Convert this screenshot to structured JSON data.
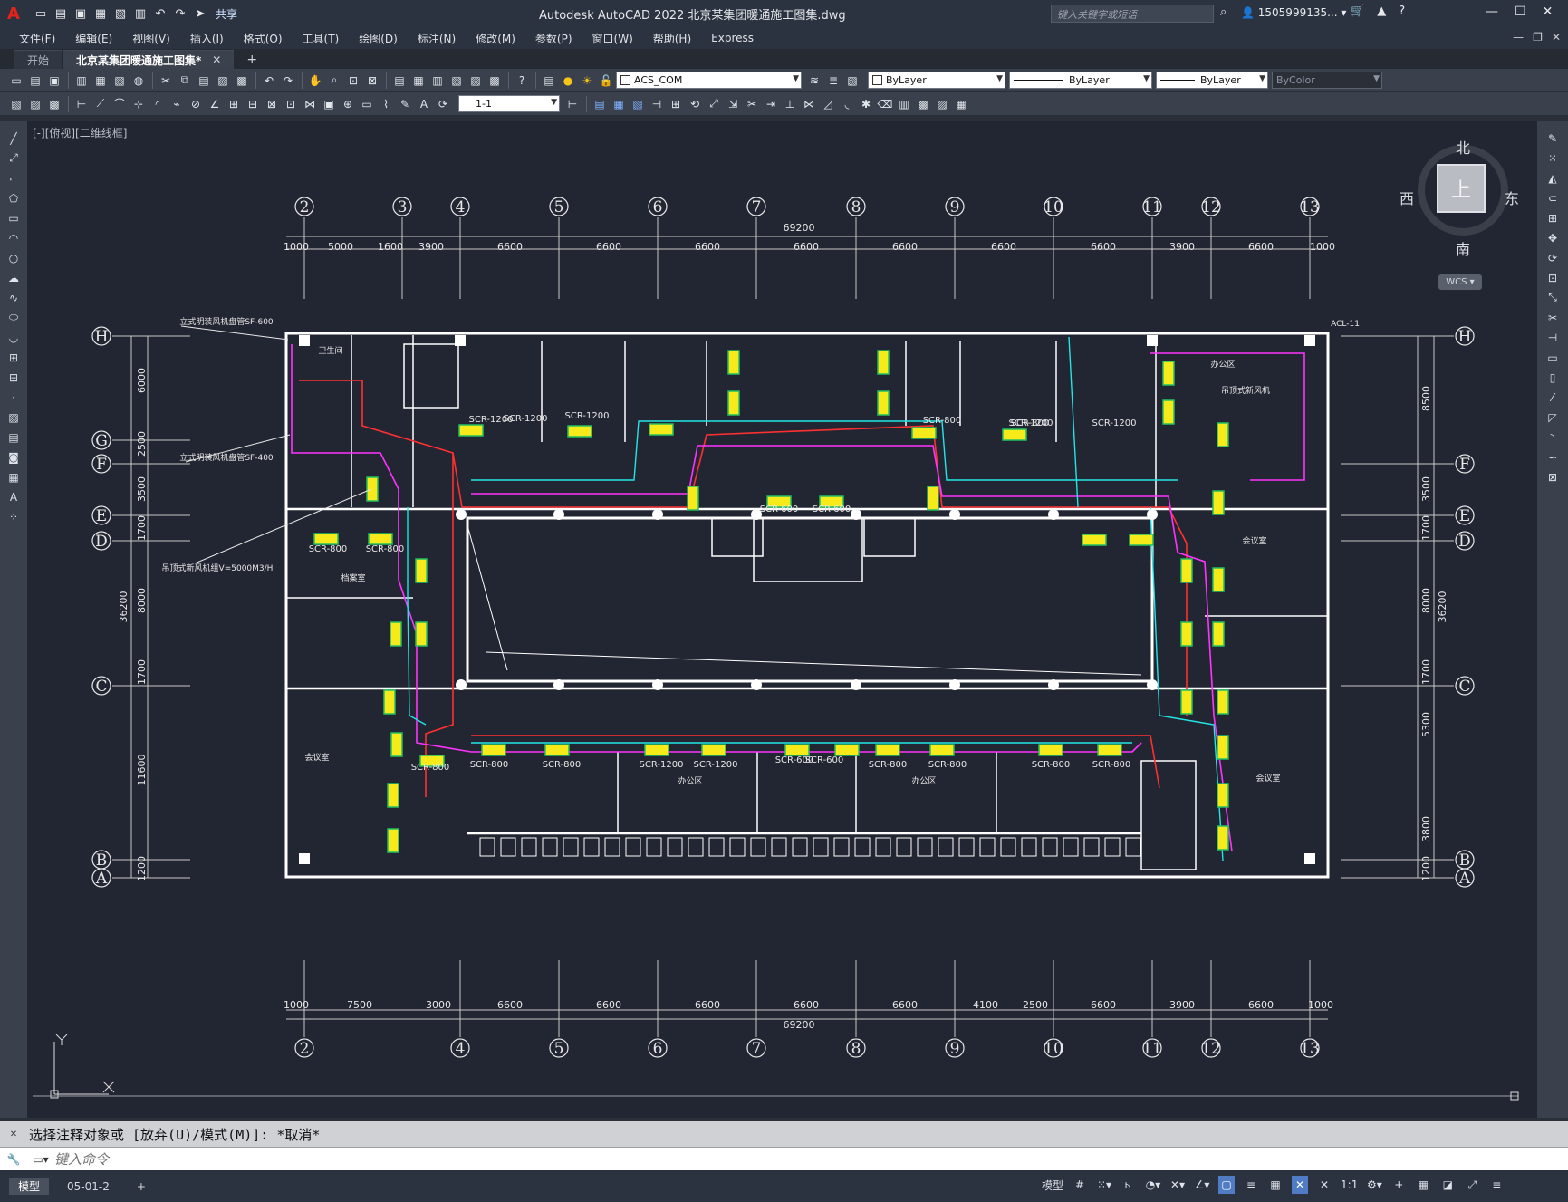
{
  "app": {
    "title": "Autodesk AutoCAD 2022    北京某集团暖通施工图集.dwg",
    "share_label": "共享",
    "search_placeholder": "键入关键字或短语",
    "user": "1505999135...",
    "accent": "#e2231a"
  },
  "menu": [
    "文件(F)",
    "编辑(E)",
    "视图(V)",
    "插入(I)",
    "格式(O)",
    "工具(T)",
    "绘图(D)",
    "标注(N)",
    "修改(M)",
    "参数(P)",
    "窗口(W)",
    "帮助(H)",
    "Express"
  ],
  "doc_tabs": [
    {
      "label": "开始",
      "active": false
    },
    {
      "label": "北京某集团暖通施工图集*",
      "active": true
    }
  ],
  "toolbar": {
    "layer": "ACS_COM",
    "color": "ByLayer",
    "linetype": "ByLayer",
    "lineweight": "ByLayer",
    "plotstyle": "ByColor",
    "dimstyle": "1-1"
  },
  "viewport": {
    "label": "[-][俯视][二维线框]",
    "compass": {
      "n": "北",
      "s": "南",
      "w": "西",
      "e": "东",
      "face": "上"
    },
    "wcs": "WCS"
  },
  "drawing": {
    "top_axes": [
      "2",
      "3",
      "4",
      "5",
      "6",
      "7",
      "8",
      "9",
      "10",
      "11",
      "12",
      "13"
    ],
    "bottom_axes": [
      "2",
      "4",
      "5",
      "6",
      "7",
      "8",
      "9",
      "10",
      "11",
      "12",
      "13"
    ],
    "left_axes": [
      "H",
      "G",
      "F",
      "E",
      "D",
      "C",
      "B",
      "A"
    ],
    "right_axes": [
      "H",
      "F",
      "E",
      "D",
      "C",
      "B",
      "A"
    ],
    "top_total": "69200",
    "top_dims": [
      "1000",
      "5000",
      "1600",
      "3900",
      "6600",
      "6600",
      "6600",
      "6600",
      "6600",
      "6600",
      "6600",
      "3900",
      "6600",
      "1000"
    ],
    "bottom_total": "69200",
    "bottom_dims": [
      "1000",
      "7500",
      "3000",
      "6600",
      "6600",
      "6600",
      "6600",
      "6600",
      "4100",
      "2500",
      "6600",
      "3900",
      "6600",
      "1000"
    ],
    "left_dims": [
      "6000",
      "2500",
      "3500",
      "1700",
      "8000",
      "1700",
      "11600",
      "1200"
    ],
    "left_total": "36200",
    "right_dims": [
      "8500",
      "3500",
      "1700",
      "8000",
      "1700",
      "5300",
      "3800",
      "1200"
    ],
    "right_total": "36200",
    "unit_labels": [
      "SCR-1200",
      "SCR-1200",
      "SCR-1200",
      "SCR-1200",
      "SCR-1200",
      "SCR-800",
      "SCR-800",
      "SCR-600",
      "SCR-600",
      "SCR-800",
      "SCR-800",
      "SCR-1200",
      "SCR-1200",
      "SCR-800",
      "SCR-800",
      "SCR-800",
      "SCR-800",
      "SCR-600",
      "SCR-600",
      "SCR-800",
      "SCR-800",
      "SCR-800"
    ],
    "notes": [
      "立式明装风机盘管SF-600",
      "立式明装风机盘管SF-400",
      "吊顶式新风机组V=5000M3/H",
      "吊顶式新风机",
      "ACL-11"
    ],
    "rooms": [
      "卫生间",
      "会议室",
      "办公区",
      "办公区",
      "档案室",
      "会议室",
      "会议室",
      "办公区"
    ]
  },
  "command": {
    "history": "选择注释对象或 [放弃(U)/模式(M)]: *取消*",
    "placeholder": "键入命令"
  },
  "status": {
    "layout_tabs": [
      "模型",
      "05-01-2"
    ],
    "model_label": "模型",
    "scale": "1:1"
  }
}
